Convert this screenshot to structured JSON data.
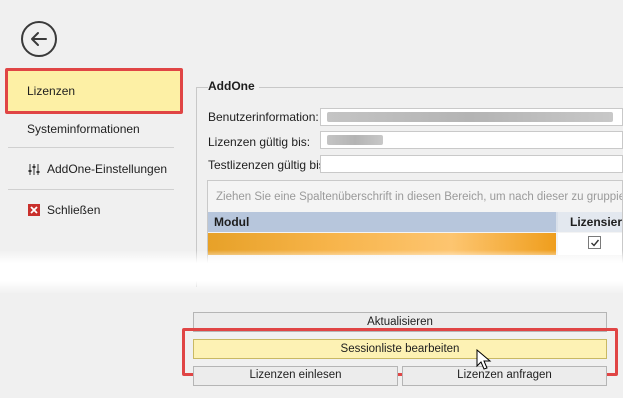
{
  "sidebar": {
    "back_icon": "arrow-left-circle-icon",
    "items": [
      {
        "label": "Lizenzen",
        "selected": true
      },
      {
        "label": "Systeminformationen"
      },
      {
        "label": "AddOne-Einstellungen",
        "icon": "sliders-icon"
      },
      {
        "label": "Schließen",
        "icon": "close-box-icon"
      }
    ]
  },
  "main": {
    "group_title": "AddOne",
    "fields": [
      {
        "label": "Benutzerinformation:",
        "value": ""
      },
      {
        "label": "Lizenzen gültig bis:",
        "value": ""
      },
      {
        "label": "Testlizenzen gültig bis:",
        "value": ""
      }
    ],
    "grid": {
      "group_hint": "Ziehen Sie eine Spaltenüberschrift in diesen Bereich, um nach dieser zu gruppieren",
      "columns": [
        "Modul",
        "Lizensiert"
      ],
      "rows": [
        {
          "modul": "",
          "lizensiert": true
        }
      ]
    },
    "buttons": {
      "aktualisieren": "Aktualisieren",
      "sessionliste": "Sessionliste bearbeiten",
      "einlesen": "Lizenzen einlesen",
      "anfragen": "Lizenzen anfragen"
    }
  },
  "colors": {
    "selection": "#fdf0a5",
    "highlight_border": "#e04545",
    "row_selected": "#f7b44a",
    "close_icon": "#c9302c"
  }
}
